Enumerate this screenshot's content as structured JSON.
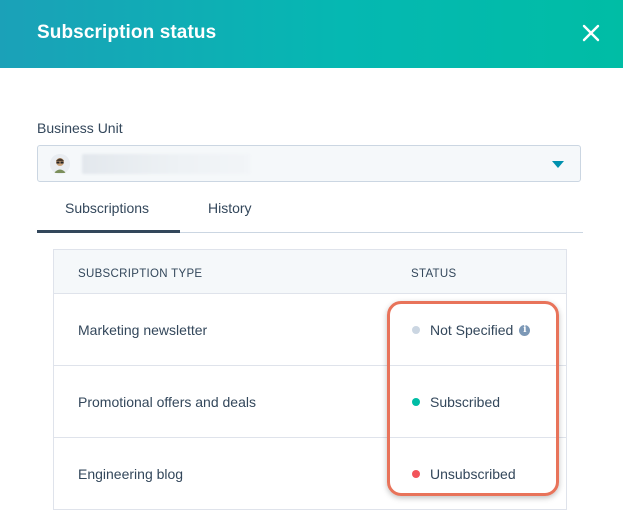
{
  "modal": {
    "title": "Subscription status",
    "close_icon": "close-icon"
  },
  "business_unit": {
    "label": "Business Unit",
    "avatar_icon": "avatar-icon",
    "dropdown_icon": "caret-down-icon"
  },
  "tabs": [
    {
      "label": "Subscriptions",
      "active": true
    },
    {
      "label": "History",
      "active": false
    }
  ],
  "table": {
    "columns": [
      "SUBSCRIPTION TYPE",
      "STATUS"
    ],
    "rows": [
      {
        "type": "Marketing newsletter",
        "status": "Not Specified",
        "status_color": "#cbd6e2",
        "info_icon": true
      },
      {
        "type": "Promotional offers and deals",
        "status": "Subscribed",
        "status_color": "#00bda5",
        "info_icon": false
      },
      {
        "type": "Engineering blog",
        "status": "Unsubscribed",
        "status_color": "#f2545b",
        "info_icon": false
      }
    ]
  },
  "colors": {
    "header_gradient_start": "#1ba1b8",
    "header_gradient_end": "#00bda5",
    "highlight": "#e8735a",
    "text": "#33475b"
  }
}
